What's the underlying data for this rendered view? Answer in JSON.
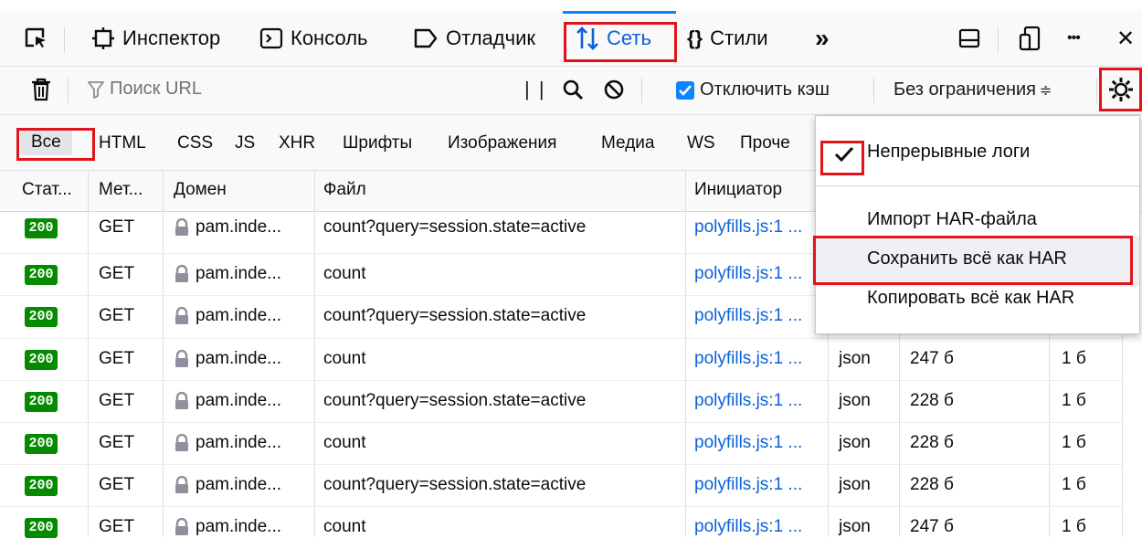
{
  "toolbar": {
    "tabs": [
      {
        "label": "Инспектор"
      },
      {
        "label": "Консоль"
      },
      {
        "label": "Отладчик"
      },
      {
        "label": "Сеть"
      },
      {
        "label": "Стили"
      }
    ],
    "styles_icon_text": "{}",
    "more_tabs_glyph": "»",
    "more_glyph": "•••",
    "close_glyph": "✕",
    "active_tab": "Сеть"
  },
  "network_toolbar": {
    "search_placeholder": "Поиск URL",
    "pause_glyph": "| |",
    "disable_cache_label": "Отключить кэш",
    "disable_cache_checked": true,
    "throttling_value": "Без ограничения",
    "throttling_arrow": "≑"
  },
  "filters": {
    "items": [
      "Все",
      "HTML",
      "CSS",
      "JS",
      "XHR",
      "Шрифты",
      "Изображения",
      "Медиа",
      "WS",
      "Проче"
    ],
    "active": "Все"
  },
  "table": {
    "columns": [
      "Стат...",
      "Мет...",
      "Домен",
      "Файл",
      "Инициатор"
    ],
    "rows": [
      {
        "status": "200",
        "method": "GET",
        "domain": "pam.inde...",
        "file": "count?query=session.state=active",
        "initiator": "polyfills.js:1 ...",
        "type": "",
        "transferred": "",
        "size": ""
      },
      {
        "status": "200",
        "method": "GET",
        "domain": "pam.inde...",
        "file": "count",
        "initiator": "polyfills.js:1 ...",
        "type": "",
        "transferred": "",
        "size": ""
      },
      {
        "status": "200",
        "method": "GET",
        "domain": "pam.inde...",
        "file": "count?query=session.state=active",
        "initiator": "polyfills.js:1 ...",
        "type": "",
        "transferred": "",
        "size": ""
      },
      {
        "status": "200",
        "method": "GET",
        "domain": "pam.inde...",
        "file": "count",
        "initiator": "polyfills.js:1 ...",
        "type": "json",
        "transferred": "247 б",
        "size": "1 б"
      },
      {
        "status": "200",
        "method": "GET",
        "domain": "pam.inde...",
        "file": "count?query=session.state=active",
        "initiator": "polyfills.js:1 ...",
        "type": "json",
        "transferred": "228 б",
        "size": "1 б"
      },
      {
        "status": "200",
        "method": "GET",
        "domain": "pam.inde...",
        "file": "count",
        "initiator": "polyfills.js:1 ...",
        "type": "json",
        "transferred": "228 б",
        "size": "1 б"
      },
      {
        "status": "200",
        "method": "GET",
        "domain": "pam.inde...",
        "file": "count?query=session.state=active",
        "initiator": "polyfills.js:1 ...",
        "type": "json",
        "transferred": "228 б",
        "size": "1 б"
      },
      {
        "status": "200",
        "method": "GET",
        "domain": "pam.inde...",
        "file": "count",
        "initiator": "polyfills.js:1 ...",
        "type": "json",
        "transferred": "247 б",
        "size": "1 б"
      }
    ]
  },
  "settings_menu": {
    "persist_logs_label": "Непрерывные логи",
    "persist_logs_checked": true,
    "import_har_label": "Импорт HAR-файла",
    "save_all_har_label": "Сохранить всё как HAR",
    "copy_all_har_label": "Копировать всё как HAR"
  },
  "colors": {
    "accent": "#0a84ff",
    "status_ok": "#058b00",
    "highlight_box": "#e0141a"
  }
}
